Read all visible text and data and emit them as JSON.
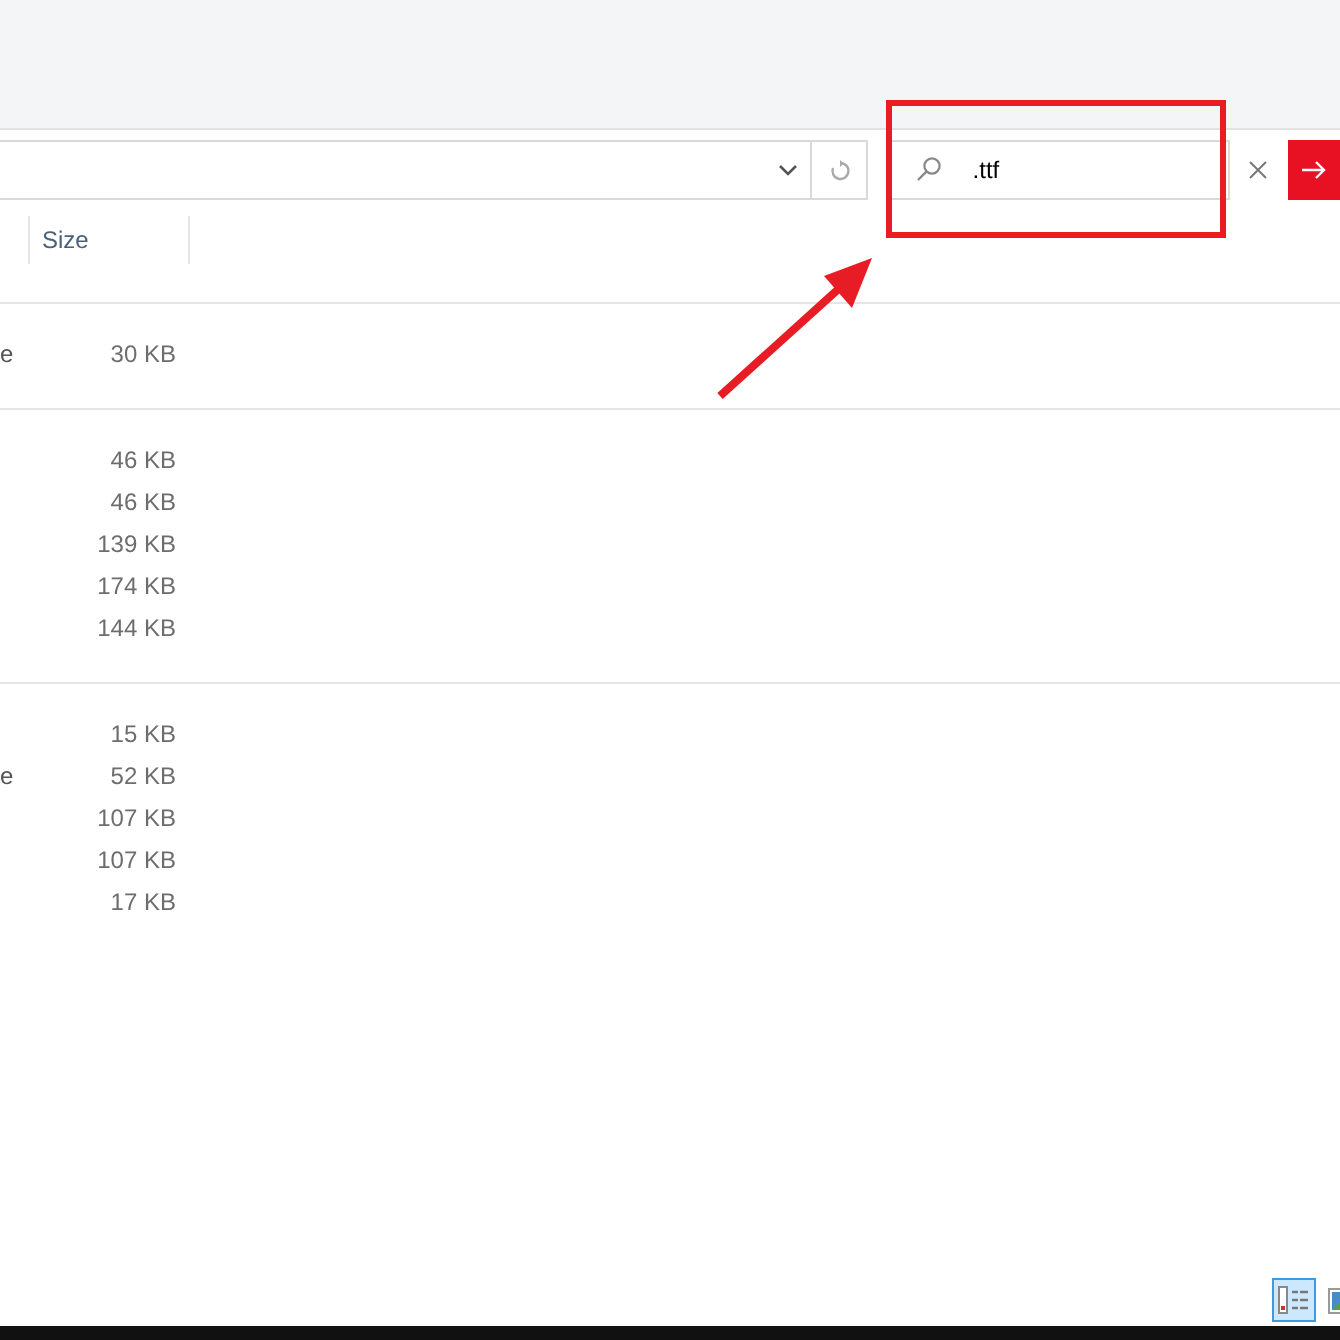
{
  "search": {
    "value": ".ttf"
  },
  "columns": [
    "Size"
  ],
  "groups": [
    {
      "rows": [
        {
          "column_1": "e",
          "size": "30 KB"
        }
      ]
    },
    {
      "rows": [
        {
          "size": "46 KB"
        },
        {
          "size": "46 KB"
        },
        {
          "size": "139 KB"
        },
        {
          "size": "174 KB"
        },
        {
          "size": "144 KB"
        }
      ]
    },
    {
      "rows": [
        {
          "size": "15 KB"
        },
        {
          "column_1": "e",
          "size": "52 KB"
        },
        {
          "size": "107 KB"
        },
        {
          "size": "107 KB"
        },
        {
          "size": "17 KB"
        }
      ]
    }
  ],
  "view_buttons": [
    {
      "kind": "details",
      "selected": true
    },
    {
      "kind": "thumbnails",
      "selected": false
    }
  ]
}
